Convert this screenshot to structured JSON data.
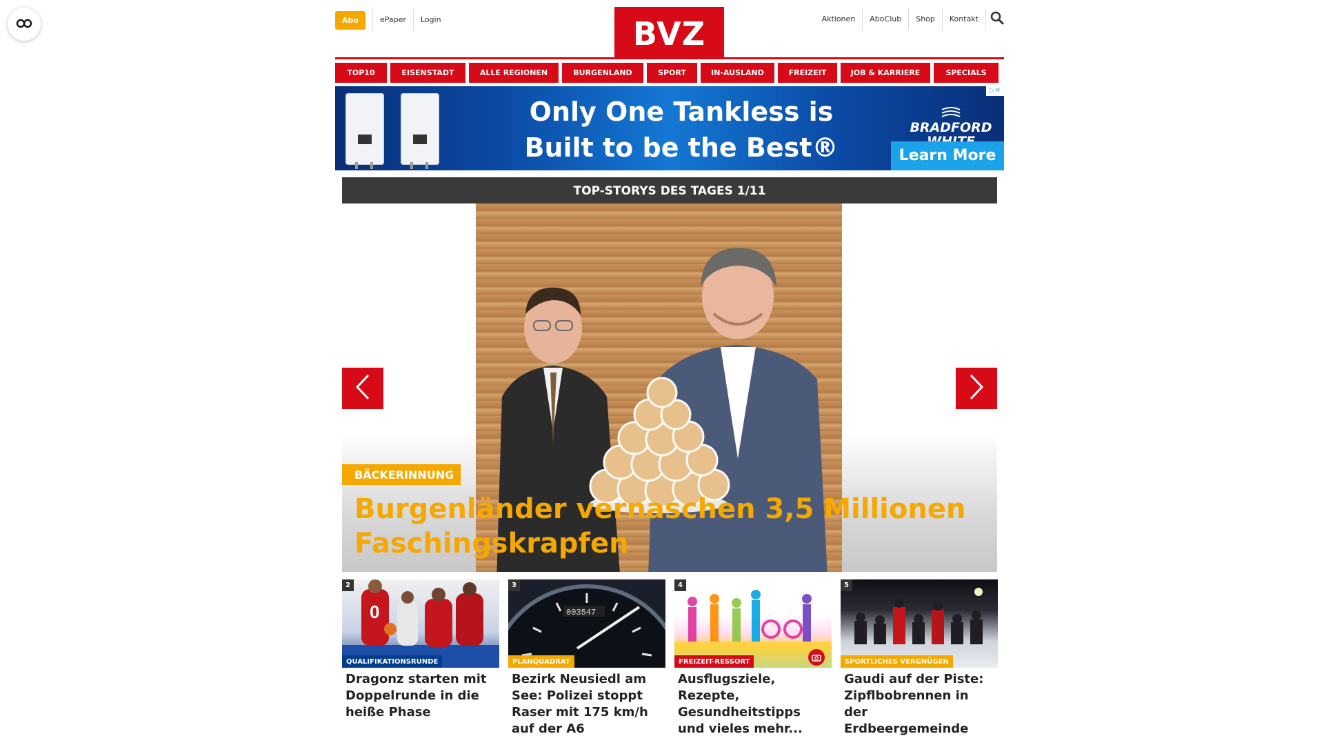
{
  "reader": {
    "icon": "glasses-icon"
  },
  "header": {
    "abo": "Abo",
    "epaper": "ePaper",
    "login": "Login",
    "logo": "BVZ",
    "right_links": [
      "Aktionen",
      "AboClub",
      "Shop",
      "Kontakt"
    ],
    "search_icon": "search-icon"
  },
  "nav": [
    "TOP10",
    "EISENSTADT",
    "ALLE REGIONEN",
    "BURGENLAND",
    "SPORT",
    "IN-AUSLAND",
    "FREIZEIT",
    "JOB & KARRIERE",
    "SPECIALS"
  ],
  "ad": {
    "headline_line1": "Only One Tankless is",
    "headline_line2": "Built to be the Best®",
    "brand_line1": "BRADFORD",
    "brand_line2": "WHITE",
    "cta": "Learn More",
    "close": "▷✕"
  },
  "top_stories": {
    "bar": "TOP-STORYS DES TAGES 1/11",
    "tag": "BÄCKERINNUNG",
    "title": "Burgenländer vernaschen 3,5 Millionen Faschingskrapfen"
  },
  "teasers": [
    {
      "num": "2",
      "category": "QUALIFIKATIONSRUNDE",
      "title": "Dragonz starten mit Doppelrunde in die heiße Phase"
    },
    {
      "num": "3",
      "category": "PLANQUADRAT",
      "title": "Bezirk Neusiedl am See: Polizei stoppt Raser mit 175 km/h auf der A6"
    },
    {
      "num": "4",
      "category": "FREIZEIT-RESSORT",
      "title": "Ausflugsziele, Rezepte, Gesundheitstipps und vieles mehr..."
    },
    {
      "num": "5",
      "category": "SPORTLICHES VERGNÜGEN",
      "title": "Gaudi auf der Piste: Zipflbobrennen in der Erdbeergemeinde"
    }
  ],
  "colors": {
    "brand_red": "#d70a18",
    "accent_yellow": "#f5a800",
    "bar_dark": "#3a3a3a",
    "category_blue": "#003d8f"
  }
}
